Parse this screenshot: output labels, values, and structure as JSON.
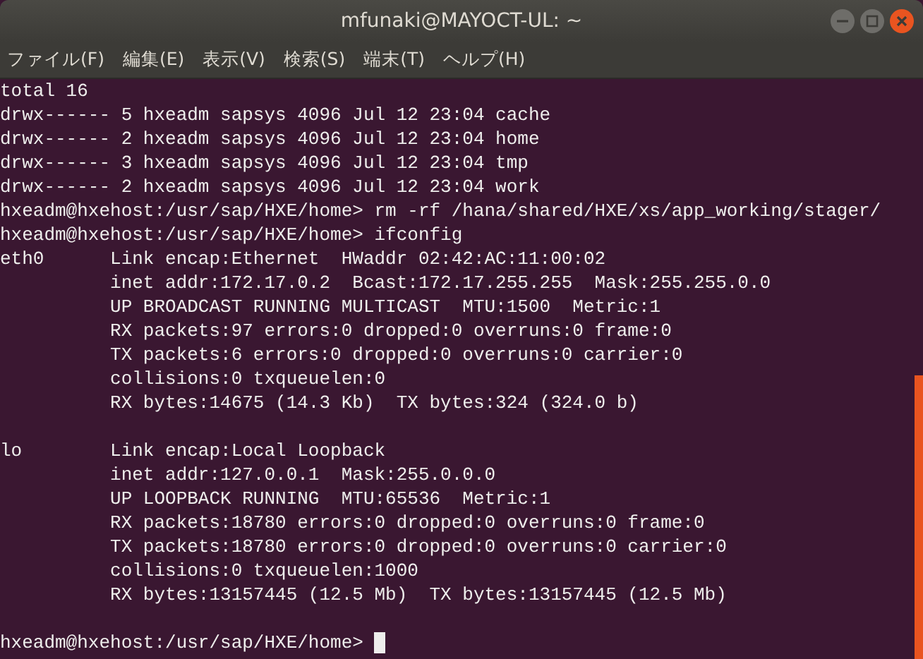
{
  "window": {
    "title": "mfunaki@MAYOCT-UL: ~"
  },
  "menu": [
    "ファイル(F)",
    "編集(E)",
    "表示(V)",
    "検索(S)",
    "端末(T)",
    "ヘルプ(H)"
  ],
  "terminal": {
    "blocks": [
      [
        "total 16",
        "drwx------ 5 hxeadm sapsys 4096 Jul 12 23:04 cache",
        "drwx------ 2 hxeadm sapsys 4096 Jul 12 23:04 home",
        "drwx------ 3 hxeadm sapsys 4096 Jul 12 23:04 tmp",
        "drwx------ 2 hxeadm sapsys 4096 Jul 12 23:04 work",
        "hxeadm@hxehost:/usr/sap/HXE/home> rm -rf /hana/shared/HXE/xs/app_working/stager/",
        "hxeadm@hxehost:/usr/sap/HXE/home> ifconfig",
        "eth0      Link encap:Ethernet  HWaddr 02:42:AC:11:00:02",
        "          inet addr:172.17.0.2  Bcast:172.17.255.255  Mask:255.255.0.0",
        "          UP BROADCAST RUNNING MULTICAST  MTU:1500  Metric:1",
        "          RX packets:97 errors:0 dropped:0 overruns:0 frame:0",
        "          TX packets:6 errors:0 dropped:0 overruns:0 carrier:0",
        "          collisions:0 txqueuelen:0",
        "          RX bytes:14675 (14.3 Kb)  TX bytes:324 (324.0 b)"
      ],
      [
        "lo        Link encap:Local Loopback",
        "          inet addr:127.0.0.1  Mask:255.0.0.0",
        "          UP LOOPBACK RUNNING  MTU:65536  Metric:1",
        "          RX packets:18780 errors:0 dropped:0 overruns:0 frame:0",
        "          TX packets:18780 errors:0 dropped:0 overruns:0 carrier:0",
        "          collisions:0 txqueuelen:1000",
        "          RX bytes:13157445 (12.5 Mb)  TX bytes:13157445 (12.5 Mb)"
      ]
    ],
    "prompt": "hxeadm@hxehost:/usr/sap/HXE/home>"
  }
}
